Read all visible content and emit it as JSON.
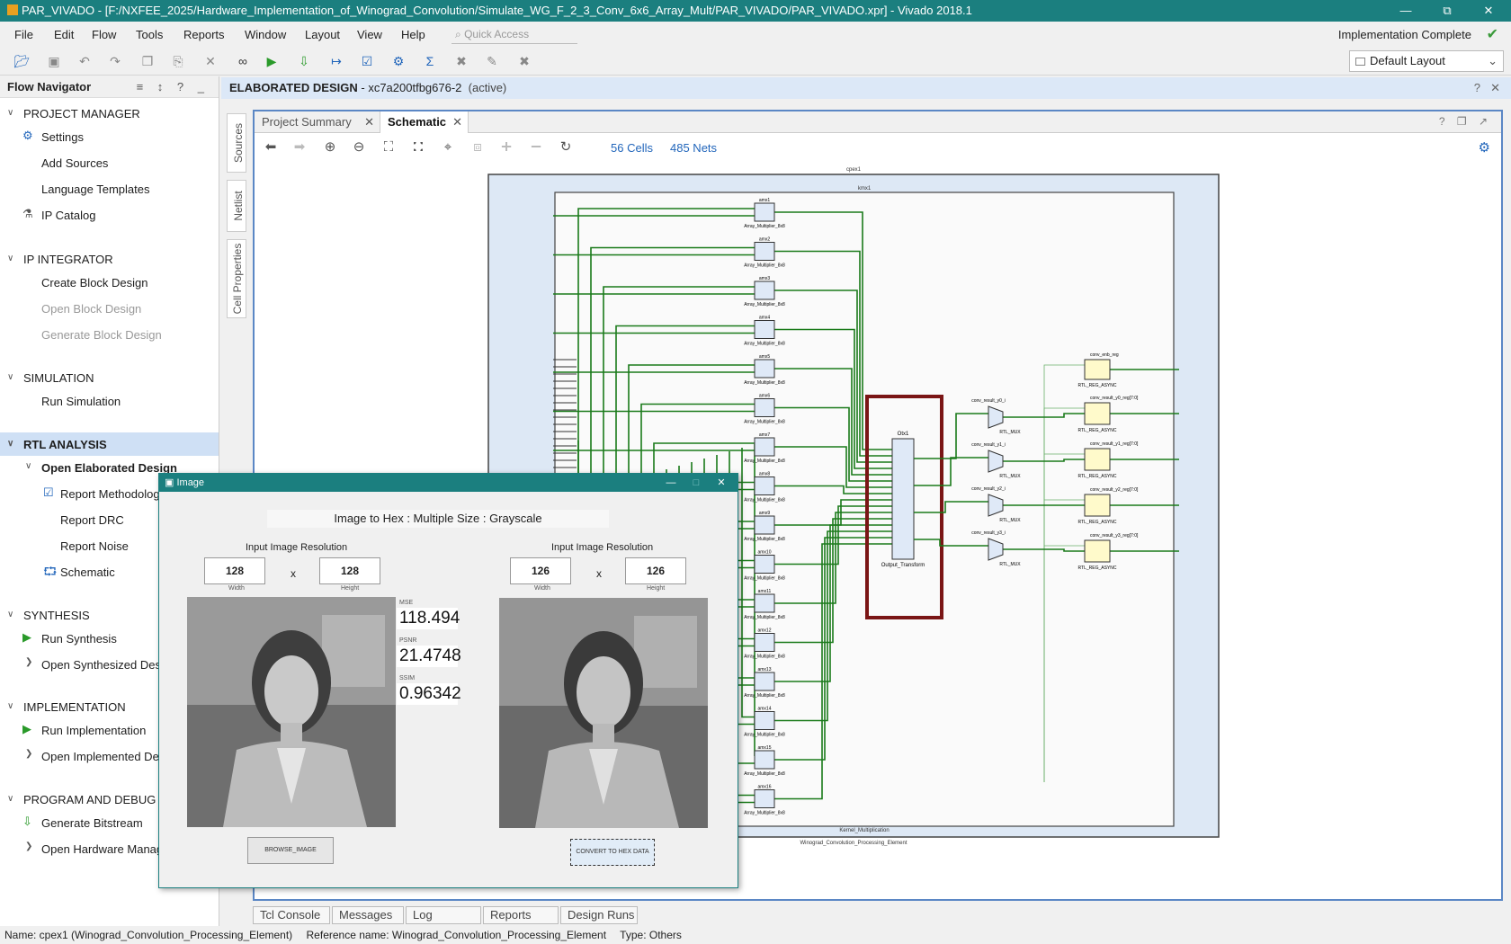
{
  "window": {
    "title": "PAR_VIVADO - [F:/NXFEE_2025/Hardware_Implementation_of_Winograd_Convolution/Simulate_WG_F_2_3_Conv_6x6_Array_Mult/PAR_VIVADO/PAR_VIVADO.xpr] - Vivado 2018.1",
    "minimize": "—",
    "restore": "⧉",
    "close": "✕"
  },
  "menu": [
    "File",
    "Edit",
    "Flow",
    "Tools",
    "Reports",
    "Window",
    "Layout",
    "View",
    "Help"
  ],
  "quick_access": "Quick Access",
  "implementation_status": "Implementation Complete",
  "layout_select": "Default Layout",
  "navigator": {
    "title": "Flow Navigator",
    "sections": {
      "project_manager": "PROJECT MANAGER",
      "ip_integrator": "IP INTEGRATOR",
      "simulation": "SIMULATION",
      "rtl_analysis": "RTL ANALYSIS",
      "synthesis": "SYNTHESIS",
      "implementation": "IMPLEMENTATION",
      "program_debug": "PROGRAM AND DEBUG"
    },
    "items": {
      "settings": "Settings",
      "add_sources": "Add Sources",
      "language_templates": "Language Templates",
      "ip_catalog": "IP Catalog",
      "create_block_design": "Create Block Design",
      "open_block_design": "Open Block Design",
      "generate_block_design": "Generate Block Design",
      "run_simulation": "Run Simulation",
      "open_elaborated_design": "Open Elaborated Design",
      "report_methodology": "Report Methodology",
      "report_drc": "Report DRC",
      "report_noise": "Report Noise",
      "schematic": "Schematic",
      "run_synthesis": "Run Synthesis",
      "open_synthesized_design": "Open Synthesized Desi",
      "run_implementation": "Run Implementation",
      "open_implemented_design": "Open Implemented Des",
      "generate_bitstream": "Generate Bitstream",
      "open_hardware_manager": "Open Hardware Manage"
    }
  },
  "editor": {
    "header_bold": "ELABORATED DESIGN",
    "header_rest": " - xc7a200tfbg676-2",
    "header_active": "(active)",
    "side_tabs": [
      "Sources",
      "Netlist",
      "Cell Properties"
    ],
    "tabs": [
      {
        "label": "Project Summary"
      },
      {
        "label": "Schematic"
      }
    ],
    "cells": "56 Cells",
    "nets": "485 Nets"
  },
  "schematic": {
    "top": "cpex1",
    "inner": "kmx1",
    "inner_bottom": "Kernel_Multiplication",
    "top_bottom": "Winograd_Convolution_Processing_Element",
    "multipliers": [
      {
        "name": "amx1",
        "type": "Array_Multiplier_8x8"
      },
      {
        "name": "amx2",
        "type": "Array_Multiplier_8x8"
      },
      {
        "name": "amx3",
        "type": "Array_Multiplier_8x8"
      },
      {
        "name": "amx4",
        "type": "Array_Multiplier_8x8"
      },
      {
        "name": "amx5",
        "type": "Array_Multiplier_8x8"
      },
      {
        "name": "amx6",
        "type": "Array_Multiplier_8x8"
      },
      {
        "name": "amx7",
        "type": "Array_Multiplier_8x8"
      },
      {
        "name": "amx8",
        "type": "Array_Multiplier_8x8"
      },
      {
        "name": "amx9",
        "type": "Array_Multiplier_8x8"
      },
      {
        "name": "amx10",
        "type": "Array_Multiplier_8x8"
      },
      {
        "name": "amx11",
        "type": "Array_Multiplier_8x8"
      },
      {
        "name": "amx12",
        "type": "Array_Multiplier_8x8"
      },
      {
        "name": "amx13",
        "type": "Array_Multiplier_8x8"
      },
      {
        "name": "amx14",
        "type": "Array_Multiplier_8x8"
      },
      {
        "name": "amx15",
        "type": "Array_Multiplier_8x8"
      },
      {
        "name": "amx16",
        "type": "Array_Multiplier_8x8"
      }
    ],
    "output_transform": {
      "name": "Otx1",
      "type": "Output_Transform"
    },
    "muxes": [
      {
        "name": "conv_result_y0_i",
        "type": "RTL_MUX"
      },
      {
        "name": "conv_result_y1_i",
        "type": "RTL_MUX"
      },
      {
        "name": "conv_result_y2_i",
        "type": "RTL_MUX"
      },
      {
        "name": "conv_result_y3_i",
        "type": "RTL_MUX"
      }
    ],
    "regs": [
      {
        "name": "conv_enb_reg",
        "type": "RTL_REG_ASYNC"
      },
      {
        "name": "conv_result_y0_reg[7:0]",
        "type": "RTL_REG_ASYNC"
      },
      {
        "name": "conv_result_y1_reg[7:0]",
        "type": "RTL_REG_ASYNC"
      },
      {
        "name": "conv_result_y2_reg[7:0]",
        "type": "RTL_REG_ASYNC"
      },
      {
        "name": "conv_result_y3_reg[7:0]",
        "type": "RTL_REG_ASYNC"
      }
    ]
  },
  "bottom_tabs": [
    "Tcl Console",
    "Messages",
    "Log",
    "Reports",
    "Design Runs"
  ],
  "status_bar": {
    "name": "Name: cpex1 (Winograd_Convolution_Processing_Element)",
    "reference": "Reference name: Winograd_Convolution_Processing_Element",
    "type": "Type: Others"
  },
  "image_window": {
    "title": "Image",
    "heading": "Image to Hex :  Multiple Size : Grayscale",
    "left": {
      "label": "Input Image Resolution",
      "width": "128",
      "height": "128",
      "width_label": "Width",
      "height_label": "Height"
    },
    "right": {
      "label": "Input Image Resolution",
      "width": "126",
      "height": "126",
      "width_label": "Width",
      "height_label": "Height"
    },
    "x_sep": "x",
    "metrics": [
      {
        "label": "MSE",
        "value": "118.494"
      },
      {
        "label": "PSNR",
        "value": "21.4748"
      },
      {
        "label": "SSIM",
        "value": "0.96342"
      }
    ],
    "browse_button": "BROWSE_IMAGE",
    "convert_button": "CONVERT TO HEX DATA"
  },
  "colors": {
    "titlebar": "#1b7f7f",
    "wire": "#1a7a1a",
    "highlight": "#7a1515",
    "cell_fill": "#dfe9f7",
    "reg_fill": "#fffacb",
    "link": "#2266bb"
  }
}
